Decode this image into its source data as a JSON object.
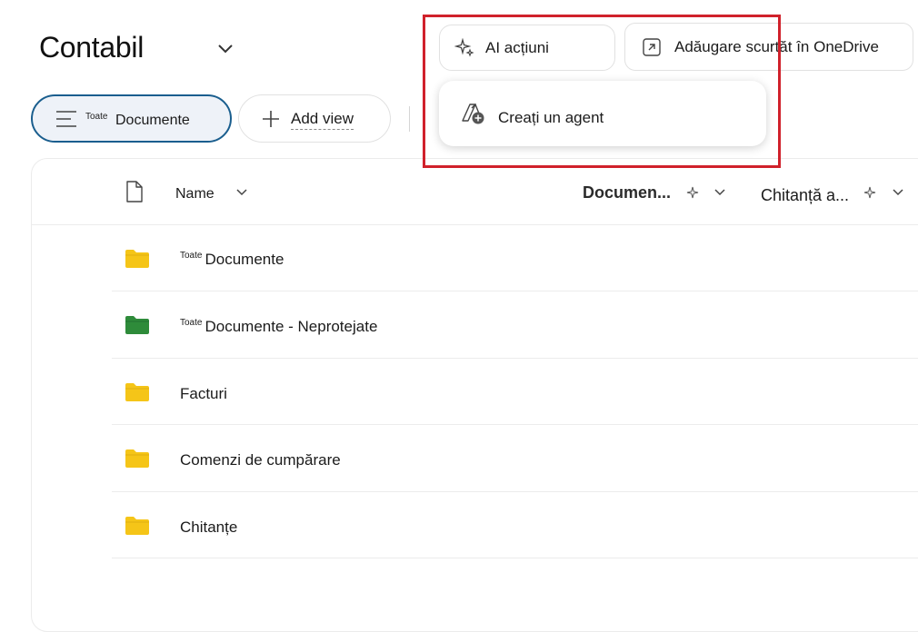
{
  "header": {
    "title": "Contabil"
  },
  "toolbar": {
    "ai_label": "AI acțiuni",
    "shortcut_label": "Adăugare scurtăt în OneDrive"
  },
  "views": {
    "current_prefix": "Toate",
    "current_label": "Documente",
    "add_view_label": "Add view"
  },
  "menu": {
    "create_agent_label": "Creați un agent"
  },
  "columns": {
    "name": "Name",
    "col2": "Documen...",
    "col3": "Chitanță a..."
  },
  "rows": [
    {
      "prefix": "Toate",
      "name": "Documente",
      "color": "#F5C518"
    },
    {
      "prefix": "Toate",
      "name": "Documente - Neprotejate",
      "color": "#2E8B3A"
    },
    {
      "prefix": "",
      "name": "Facturi",
      "color": "#F5C518"
    },
    {
      "prefix": "",
      "name": "Comenzi de cumpărare",
      "color": "#F5C518"
    },
    {
      "prefix": "",
      "name": "Chitanțe",
      "color": "#F5C518"
    }
  ],
  "colors": {
    "highlight": "#D0212B",
    "view_border": "#1A5E8E"
  }
}
